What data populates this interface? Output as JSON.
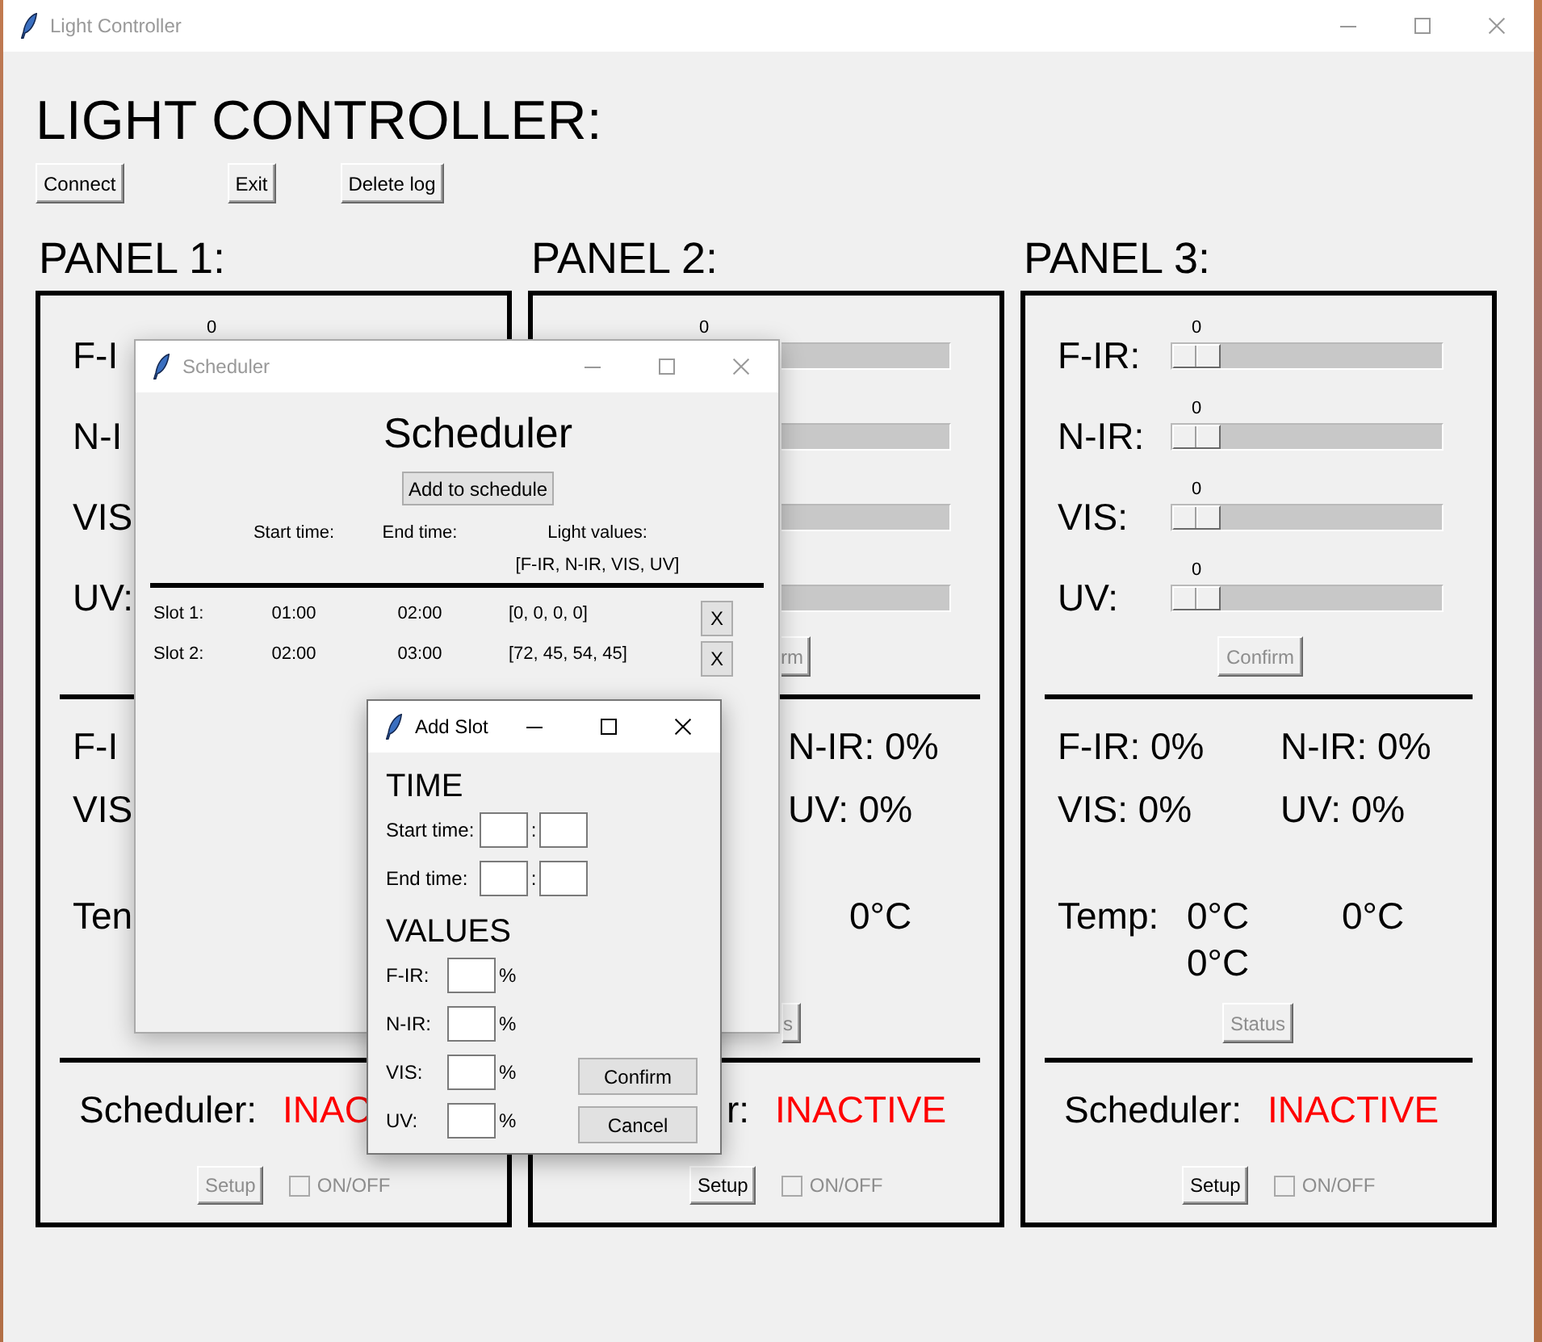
{
  "main_window": {
    "title": "Light Controller",
    "active": false,
    "heading": "LIGHT CONTROLLER:",
    "buttons": [
      "Connect",
      "Exit",
      "Delete log"
    ]
  },
  "panels": [
    {
      "title": "PANEL 1:",
      "sliders": [
        {
          "kind": "covered",
          "label": "F-I",
          "value": "0"
        },
        {
          "kind": "covered",
          "label": "N-I"
        },
        {
          "kind": "covered",
          "label": "VIS"
        },
        {
          "kind": "covered",
          "label": "UV:"
        }
      ],
      "status": {
        "f_ir": "F-I",
        "vis": "VIS",
        "temp_label": "Ten"
      },
      "scheduler": {
        "label": "Scheduler:",
        "state": "INAC"
      },
      "setup_button": {
        "label": "Setup",
        "disabled": true
      },
      "toggle": {
        "label": "ON/OFF",
        "checked": false,
        "disabled": true
      }
    },
    {
      "title": "PANEL 2:",
      "sliders": [
        {
          "kind": "partial",
          "value": "0"
        },
        {
          "kind": "partial"
        },
        {
          "kind": "partial"
        },
        {
          "kind": "partial"
        }
      ],
      "confirm_button": {
        "label": "rm",
        "disabled": true
      },
      "status": {
        "n_ir": "N-IR: 0%",
        "uv": "UV: 0%",
        "temp_2": "0°C"
      },
      "status_button": {
        "label": "s",
        "disabled": true
      },
      "scheduler": {
        "label": "r:",
        "state": "INACTIVE"
      },
      "setup_button": {
        "label": "Setup",
        "disabled": false
      },
      "toggle": {
        "label": "ON/OFF",
        "checked": false,
        "disabled": true
      }
    },
    {
      "title": "PANEL 3:",
      "sliders": [
        {
          "kind": "full",
          "label": "F-IR:",
          "value": "0",
          "level": 0
        },
        {
          "kind": "full",
          "label": "N-IR:",
          "value": "0",
          "level": 0
        },
        {
          "kind": "full",
          "label": "VIS:",
          "value": "0",
          "level": 0
        },
        {
          "kind": "full",
          "label": "UV:",
          "value": "0",
          "level": 0
        }
      ],
      "confirm_button": {
        "label": "Confirm",
        "disabled": true
      },
      "status": {
        "f_ir": "F-IR: 0%",
        "n_ir": "N-IR: 0%",
        "vis": "VIS: 0%",
        "uv": "UV: 0%",
        "temp_label": "Temp:",
        "temp_1": "0°C",
        "temp_2": "0°C",
        "temp_3": "0°C"
      },
      "status_button": {
        "label": "Status",
        "disabled": true
      },
      "scheduler": {
        "label": "Scheduler:",
        "state": "INACTIVE"
      },
      "setup_button": {
        "label": "Setup",
        "disabled": false
      },
      "toggle": {
        "label": "ON/OFF",
        "checked": false,
        "disabled": true
      }
    }
  ],
  "scheduler_window": {
    "title": "Scheduler",
    "active": false,
    "heading": "Scheduler",
    "add_button": "Add to schedule",
    "columns": [
      "Start time:",
      "End time:",
      "Light values:"
    ],
    "values_hint": "[F-IR, N-IR, VIS, UV]",
    "slots": [
      {
        "name": "Slot 1:",
        "start": "01:00",
        "end": "02:00",
        "values": "[0, 0, 0, 0]",
        "remove": "X"
      },
      {
        "name": "Slot 2:",
        "start": "02:00",
        "end": "03:00",
        "values": "[72, 45, 54, 45]",
        "remove": "X"
      }
    ]
  },
  "add_slot_dialog": {
    "title": "Add Slot",
    "active": true,
    "time_heading": "TIME",
    "time_fields": [
      {
        "label": "Start time:",
        "separator": ":"
      },
      {
        "label": "End time:",
        "separator": ":"
      }
    ],
    "values_heading": "VALUES",
    "value_fields": [
      {
        "label": "F-IR:",
        "unit": "%"
      },
      {
        "label": "N-IR:",
        "unit": "%"
      },
      {
        "label": "VIS:",
        "unit": "%"
      },
      {
        "label": "UV:",
        "unit": "%"
      }
    ],
    "buttons": [
      "Confirm",
      "Cancel"
    ]
  }
}
